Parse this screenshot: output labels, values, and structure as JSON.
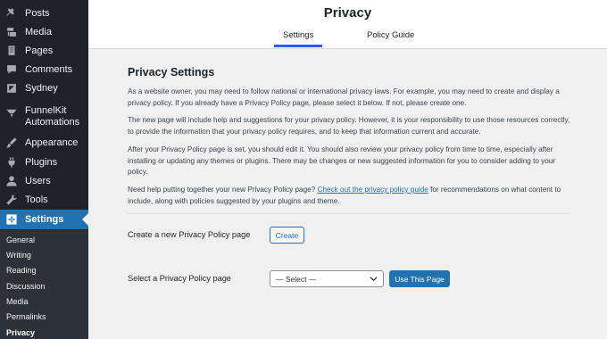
{
  "sidebar": {
    "items": [
      {
        "label": "Posts",
        "icon": "pin-icon"
      },
      {
        "label": "Media",
        "icon": "media-icon"
      },
      {
        "label": "Pages",
        "icon": "page-icon"
      },
      {
        "label": "Comments",
        "icon": "comment-icon"
      },
      {
        "label": "Sydney",
        "icon": "sydney-icon"
      },
      {
        "label": "FunnelKit Automations",
        "icon": "funnelkit-icon"
      },
      {
        "label": "Appearance",
        "icon": "brush-icon"
      },
      {
        "label": "Plugins",
        "icon": "plug-icon"
      },
      {
        "label": "Users",
        "icon": "user-icon"
      },
      {
        "label": "Tools",
        "icon": "wrench-icon"
      },
      {
        "label": "Settings",
        "icon": "settings-icon"
      }
    ],
    "submenu": [
      "General",
      "Writing",
      "Reading",
      "Discussion",
      "Media",
      "Permalinks",
      "Privacy"
    ],
    "active_color": "#2271b1"
  },
  "header": {
    "title": "Privacy",
    "tabs": [
      "Settings",
      "Policy Guide"
    ]
  },
  "main": {
    "section_title": "Privacy Settings",
    "paragraphs": [
      "As a website owner, you may need to follow national or international privacy laws. For example, you may need to create and display a privacy policy. If you already have a Privacy Policy page, please select it below. If not, please create one.",
      "The new page will include help and suggestions for your privacy policy. However, it is your responsibility to use those resources correctly, to provide the information that your privacy policy requires, and to keep that information current and accurate.",
      "After your Privacy Policy page is set, you should edit it. You should also review your privacy policy from time to time, especially after installing or updating any themes or plugins. There may be changes or new suggested information for you to consider adding to your policy."
    ],
    "help_prefix": "Need help putting together your new Privacy Policy page? ",
    "help_link": "Check out the privacy policy guide",
    "help_suffix": " for recommendations on what content to include, along with policies suggested by your plugins and theme.",
    "create_label": "Create a new Privacy Policy page",
    "create_button": "Create",
    "select_label": "Select a Privacy Policy page",
    "select_value": "— Select —",
    "use_button": "Use This Page"
  }
}
